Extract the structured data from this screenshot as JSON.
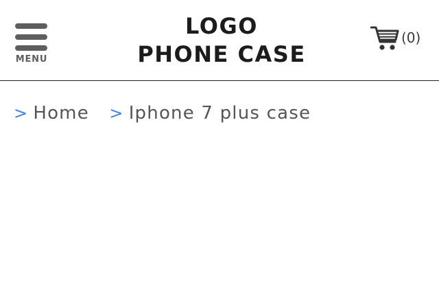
{
  "header": {
    "menu": {
      "label": "MENU",
      "icon": "hamburger-menu-icon"
    },
    "logo": {
      "line1": "LOGO",
      "line2": "PHONE CASE"
    },
    "cart": {
      "icon": "shopping-cart-icon",
      "count_label": "(0)"
    }
  },
  "breadcrumb": {
    "separator": ">",
    "separator_color": "#3b82f0",
    "items": [
      {
        "label": "Home"
      },
      {
        "label": "Iphone 7 plus case"
      }
    ]
  },
  "colors": {
    "text_primary": "#1c1c1c",
    "text_secondary": "#555555",
    "icon_gray": "#5e5e5e",
    "accent": "#3b82f0",
    "background": "#ffffff"
  }
}
